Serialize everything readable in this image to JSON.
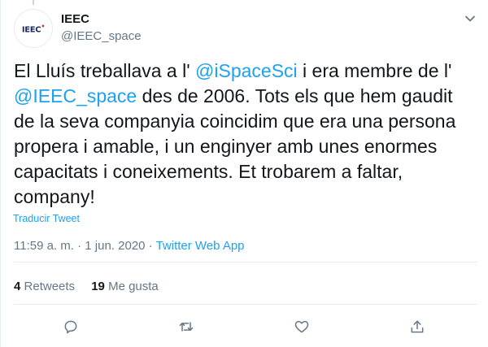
{
  "account": {
    "name": "IEEC",
    "handle": "@IEEC_space",
    "avatar_text": "IEEC",
    "avatar_mark": "•"
  },
  "tweet": {
    "text_1": "El Lluís treballava a l' ",
    "mention_1": "@iSpaceSci",
    "text_2": " i era membre de l' ",
    "mention_2": "@IEEC_space",
    "text_3": "  des de 2006. Tots els que hem gaudit de la seva companyia coincidim que era una persona propera i amable, i un enginyer amb unes enormes capacitats i coneixements. Et trobarem a faltar, company!"
  },
  "translate_label": "Traducir Tweet",
  "meta": {
    "time": "11:59 a. m.",
    "separator": " · ",
    "date": "1 jun. 2020",
    "app": "Twitter Web App"
  },
  "stats": {
    "retweets_count": "4",
    "retweets_label": "Retweets",
    "likes_count": "19",
    "likes_label": "Me gusta"
  },
  "icons": {
    "menu": "chevron-down-icon",
    "reply": "reply-icon",
    "retweet": "retweet-icon",
    "like": "heart-icon",
    "share": "share-icon"
  },
  "colors": {
    "accent": "#1da1f2",
    "secondary_text": "#657786",
    "border": "#e6ecf0"
  }
}
